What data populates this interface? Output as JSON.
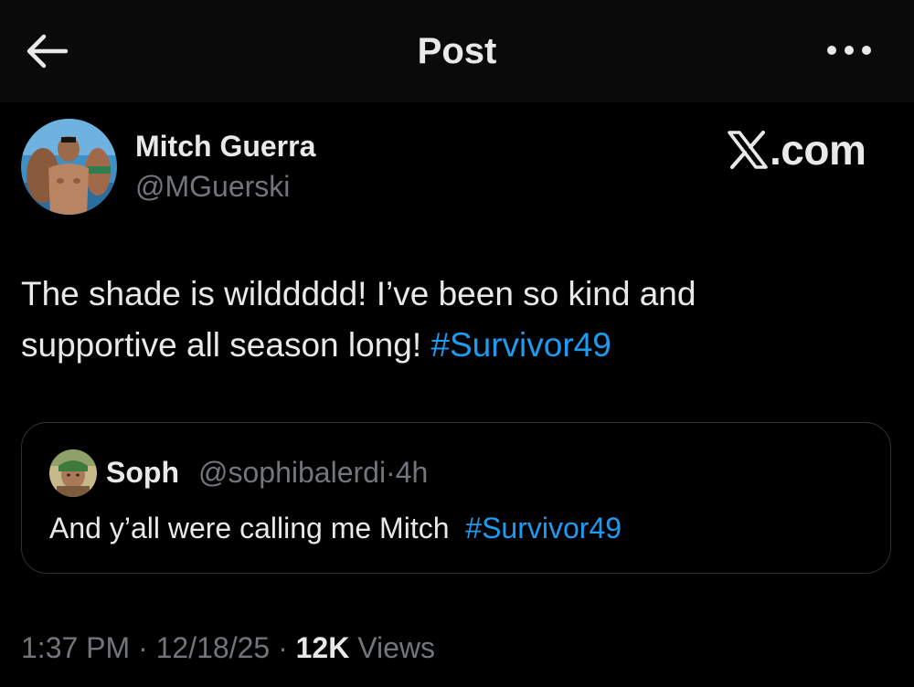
{
  "header": {
    "title": "Post",
    "back_icon": "arrow-left-icon",
    "more_icon": "more-horizontal-icon"
  },
  "author": {
    "name": "Mitch Guerra",
    "handle": "@MGuerski"
  },
  "watermark": {
    "suffix": ".com"
  },
  "post": {
    "text_line1": "The shade is wilddddd! I’ve been so kind and",
    "text_line2": "supportive all season long!",
    "hashtag": "#Survivor49"
  },
  "quote": {
    "name": "Soph",
    "handle": "@sophibalerdi",
    "separator": "·",
    "time": "4h",
    "text": "And y’all were calling me Mitch",
    "hashtag": "#Survivor49"
  },
  "meta": {
    "time": "1:37 PM",
    "date": "12/18/25",
    "separator": "·",
    "views_count": "12K",
    "views_label": "Views"
  },
  "colors": {
    "background": "#000000",
    "header_background": "#0a0a0a",
    "text_primary": "#e7e9ea",
    "text_secondary": "#71767b",
    "link": "#1d9bf0",
    "border": "#2f3336"
  }
}
